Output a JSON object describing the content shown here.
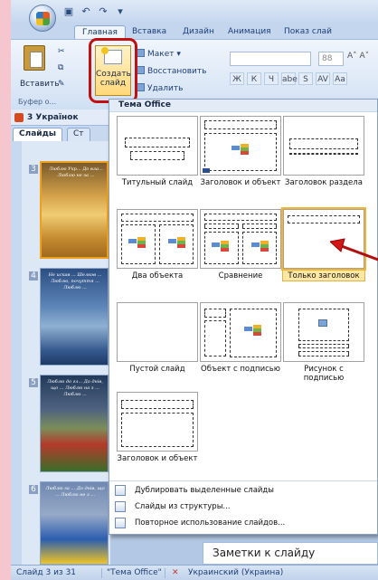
{
  "app": {
    "title_bar": "",
    "tabs": [
      {
        "label": "Главная",
        "active": true
      },
      {
        "label": "Вставка"
      },
      {
        "label": "Дизайн"
      },
      {
        "label": "Анимация"
      },
      {
        "label": "Показ слай"
      }
    ]
  },
  "ribbon": {
    "paste_label": "Вставить",
    "new_slide_label_1": "Создать",
    "new_slide_label_2": "слайд",
    "layout_label": "Макет",
    "reset_label": "Восстановить",
    "delete_label": "Удалить",
    "clipboard_group": "Буфер о...",
    "font_size": "88",
    "format_buttons": [
      "Ж",
      "К",
      "Ч",
      "abe",
      "S",
      "AV",
      "Aa"
    ]
  },
  "left_pane": {
    "presentation_title": "3 Українок",
    "tabs": [
      {
        "label": "Слайды",
        "active": true
      },
      {
        "label": "Ст"
      }
    ],
    "slides": [
      {
        "number": "3",
        "text": "Люблю Укр... До вла... Люблю не за ..."
      },
      {
        "number": "4",
        "text": "Не искав ... Шелков ... Люблю, почуття ... Люблю ..."
      },
      {
        "number": "5",
        "text": "Люблю до гл... До днів, що ... Люблю на з ... Люблю ..."
      },
      {
        "number": "6",
        "text": "Люблю за ... До днів, що ... Люблю не з ..."
      }
    ]
  },
  "gallery": {
    "theme_header": "Тема Office",
    "layouts": [
      {
        "name": "Титульный слайд"
      },
      {
        "name": "Заголовок и объект"
      },
      {
        "name": "Заголовок раздела"
      },
      {
        "name": "Два объекта"
      },
      {
        "name": "Сравнение"
      },
      {
        "name": "Только заголовок",
        "selected": true
      },
      {
        "name": "Пустой слайд"
      },
      {
        "name": "Объект с подписью"
      },
      {
        "name": "Рисунок с подписью"
      },
      {
        "name": "Заголовок и объект"
      }
    ],
    "menu_items": [
      {
        "label": "Дублировать выделенные слайды",
        "icon": "duplicate-slides-icon"
      },
      {
        "label": "Слайды из структуры...",
        "icon": "outline-slides-icon"
      },
      {
        "label": "Повторное использование слайдов...",
        "icon": "reuse-slides-icon"
      }
    ]
  },
  "notes": {
    "placeholder": "Заметки к слайду"
  },
  "status_bar": {
    "slide_info": "Слайд 3 из 31",
    "theme": "\"Тема Office\"",
    "language": "Украинский (Украина)"
  },
  "colors": {
    "highlight_border": "#c01010",
    "selected_layout": "#fde7a5",
    "ribbon_bg": "#dbe7f6"
  }
}
